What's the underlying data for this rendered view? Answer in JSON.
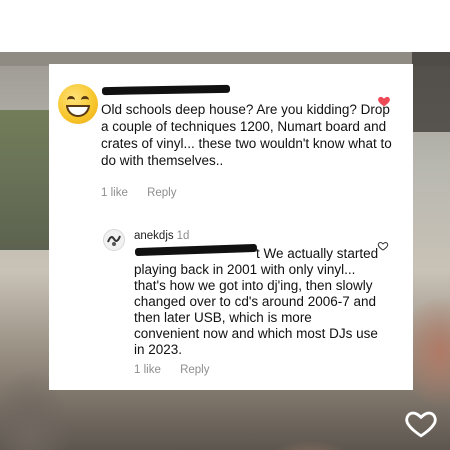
{
  "comment1": {
    "text": "Old schools deep house? Are you kidding? Drop a couple of techniques 1200, Numart board and crates of vinyl... these two wouldn't know what to do with themselves..",
    "likes": "1 like",
    "reply": "Reply"
  },
  "comment2": {
    "username": "anekdjs",
    "time": "1d",
    "text_lead": "t",
    "text": "We actually started playing back in 2001 with only vinyl... that's how we got into dj'ing, then slowly changed over to cd's around 2006-7 and then later USB, which is more convenient now and which most DJs use in 2023.",
    "likes": "1 like",
    "reply": "Reply"
  },
  "colors": {
    "heart_filled": "#ed4956",
    "meta_text": "#8e8e8e"
  },
  "icons": [
    "grinning-emoji-avatar",
    "heart-filled-icon",
    "heart-outline-icon",
    "like-heart-icon"
  ]
}
